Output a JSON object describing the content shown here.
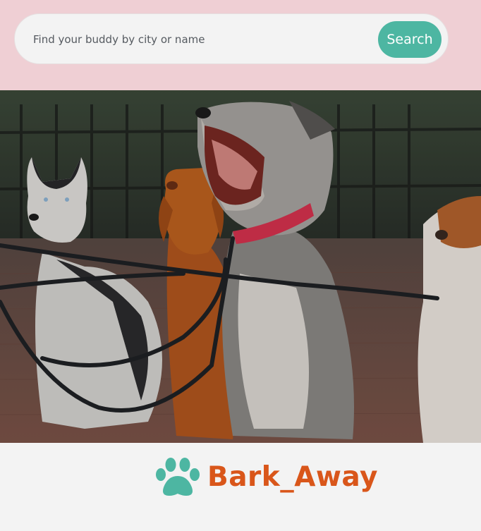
{
  "search": {
    "placeholder": "Find your buddy by city or name",
    "value": "",
    "button_label": "Search"
  },
  "hero": {
    "subject": "dogs-on-leashes-photo"
  },
  "brand": {
    "name": "Bark_Away",
    "icon": "paw-icon"
  },
  "colors": {
    "header_bg": "#efcfd4",
    "accent": "#4db6a2",
    "brand_text": "#d9561a",
    "page_bg": "#f3f3f3"
  }
}
